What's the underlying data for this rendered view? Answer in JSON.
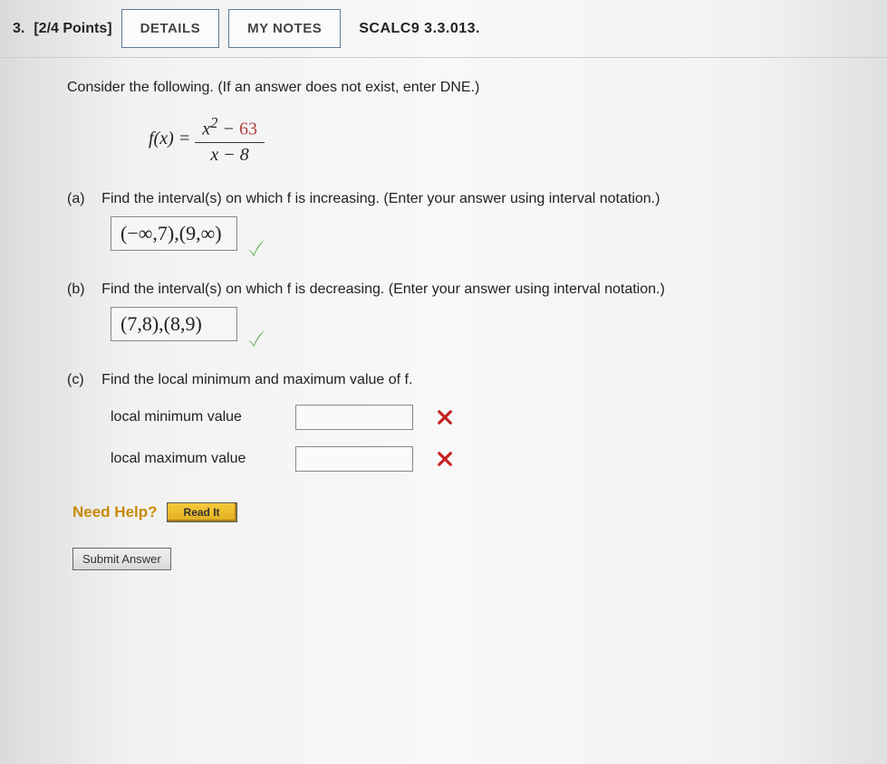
{
  "header": {
    "number": "3.",
    "points": "[2/4 Points]",
    "details_btn": "DETAILS",
    "notes_btn": "MY NOTES",
    "qref": "SCALC9 3.3.013."
  },
  "prompt": "Consider the following. (If an answer does not exist, enter DNE.)",
  "formula": {
    "lhs": "f(x) = ",
    "num_var": "x",
    "num_exp": "2",
    "num_op": " − ",
    "num_const": "63",
    "den": "x − 8"
  },
  "parts": {
    "a": {
      "label": "(a)",
      "text": "Find the interval(s) on which f is increasing. (Enter your answer using interval notation.)",
      "answer": "(−∞,7),(9,∞)",
      "status": "correct"
    },
    "b": {
      "label": "(b)",
      "text": "Find the interval(s) on which f is decreasing. (Enter your answer using interval notation.)",
      "answer": "(7,8),(8,9)",
      "status": "correct"
    },
    "c": {
      "label": "(c)",
      "text": "Find the local minimum and maximum value of f.",
      "min_label": "local minimum value",
      "min_value": "",
      "min_status": "incorrect",
      "max_label": "local maximum value",
      "max_value": "",
      "max_status": "incorrect"
    }
  },
  "help": {
    "label": "Need Help?",
    "readit": "Read It"
  },
  "submit": "Submit Answer"
}
